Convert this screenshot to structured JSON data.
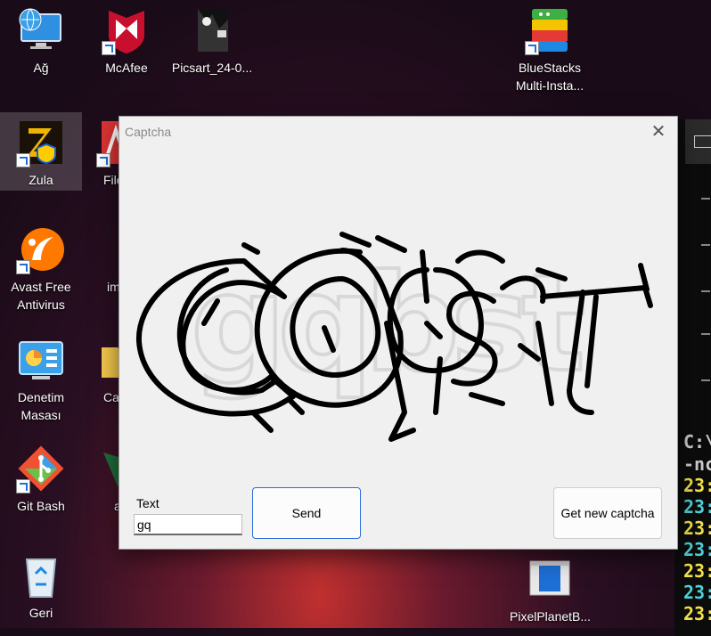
{
  "desktop": {
    "icons": [
      {
        "label": "Ağ"
      },
      {
        "label": "McAfee"
      },
      {
        "label": "Picsart_24-0..."
      },
      {
        "label": "BlueStacks Multi-Insta..."
      },
      {
        "label": "Zula"
      },
      {
        "label": "File"
      },
      {
        "label": "Avast Free Antivirus"
      },
      {
        "label": "im"
      },
      {
        "label": "Denetim Masası"
      },
      {
        "label": "Ca"
      },
      {
        "label": "Git Bash"
      },
      {
        "label": "a"
      },
      {
        "label": "Geri"
      },
      {
        "label": "PixelPlanetB..."
      }
    ]
  },
  "terminal": {
    "lines": [
      "C:\\",
      "-nc",
      "23:",
      "23:",
      "23:",
      "23:",
      "23:",
      "23:",
      "23:"
    ],
    "colors": [
      "#cccccc",
      "#cccccc",
      "#f2e24a",
      "#4fd2d8",
      "#f2e24a",
      "#4fd2d8",
      "#f2e24a",
      "#4fd2d8",
      "#f2e24a"
    ]
  },
  "dialog": {
    "title": "Captcha",
    "close_icon": "close-icon",
    "captcha_text": "gqbst",
    "text_label": "Text",
    "text_value": "gq",
    "send_label": "Send",
    "new_captcha_label": "Get new captcha"
  }
}
